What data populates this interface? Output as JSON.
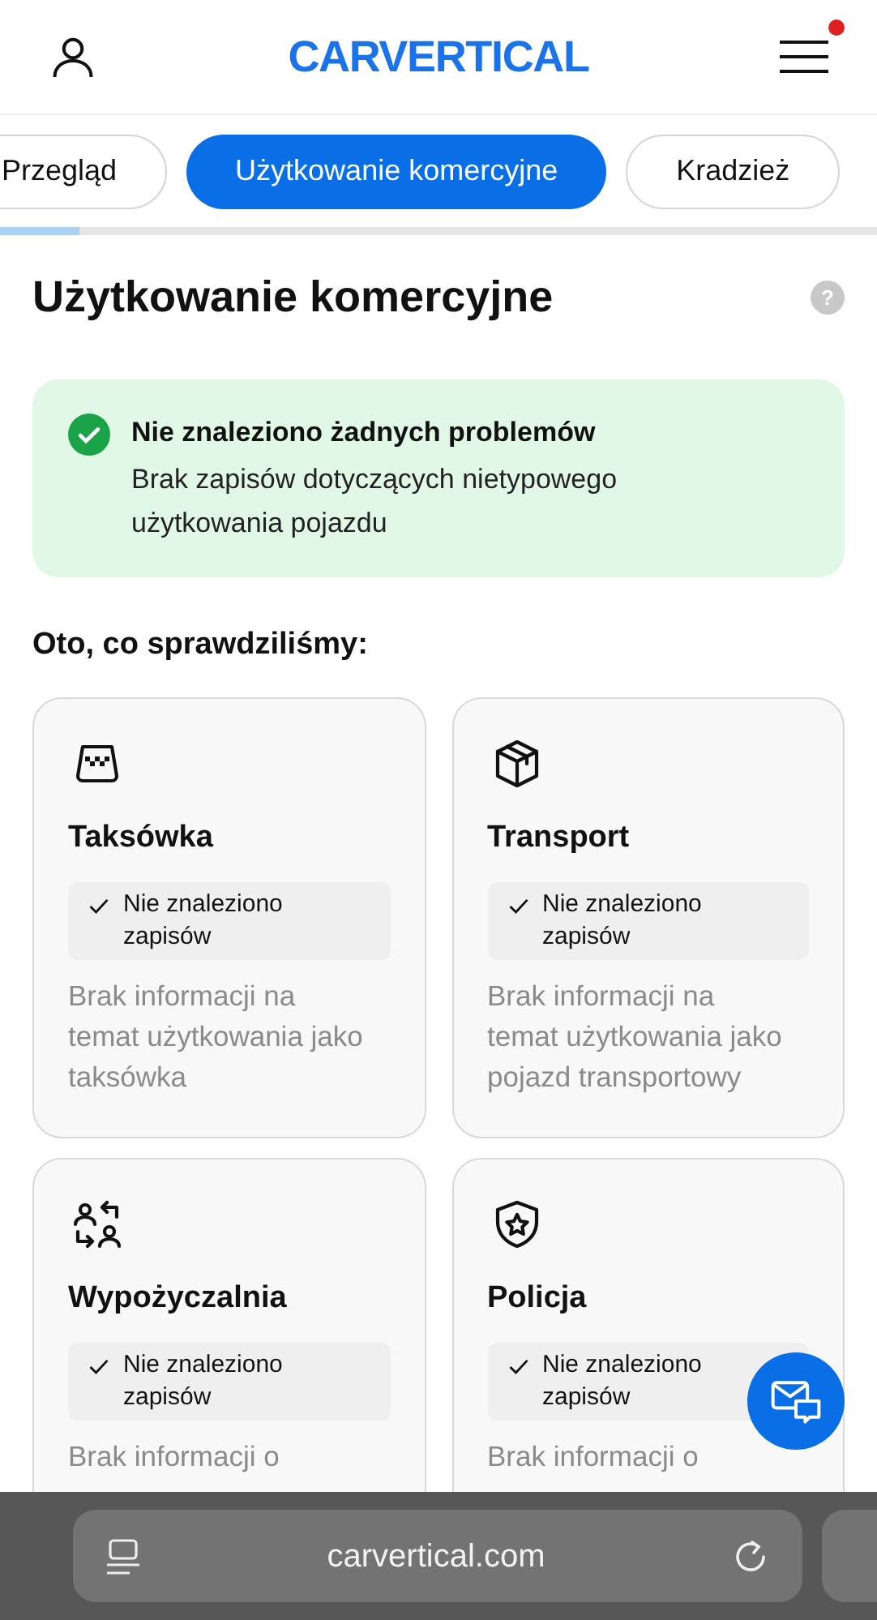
{
  "header": {
    "logo": "CARVERTICAL",
    "menu_notification": true
  },
  "tabs": [
    {
      "label": "Przegląd",
      "selected": false
    },
    {
      "label": "Użytkowanie komercyjne",
      "selected": true
    },
    {
      "label": "Kradzież",
      "selected": false
    }
  ],
  "progress": {
    "level": 0.09
  },
  "section": {
    "title": "Użytkowanie komercyjne",
    "help": "?"
  },
  "status": {
    "title": "Nie znaleziono żadnych problemów",
    "text": "Brak zapisów dotyczących nietypowego użytkowania pojazdu"
  },
  "checked_heading": "Oto, co sprawdziliśmy:",
  "cards": [
    {
      "kind": "taxi",
      "title": "Taksówka",
      "result": "Nie znaleziono zapisów",
      "text": "Brak informacji na temat użytkowania jako taksówka"
    },
    {
      "kind": "box",
      "title": "Transport",
      "result": "Nie znaleziono zapisów",
      "text": "Brak informacji na temat użytkowania jako pojazd transportowy"
    },
    {
      "kind": "rental",
      "title": "Wypożyczalnia",
      "result": "Nie znaleziono zapisów",
      "text": "Brak informacji o"
    },
    {
      "kind": "police",
      "title": "Policja",
      "result": "Nie znaleziono zapisów",
      "text": "Brak informacji o"
    }
  ],
  "browser_bar": {
    "url": "carvertical.com"
  }
}
